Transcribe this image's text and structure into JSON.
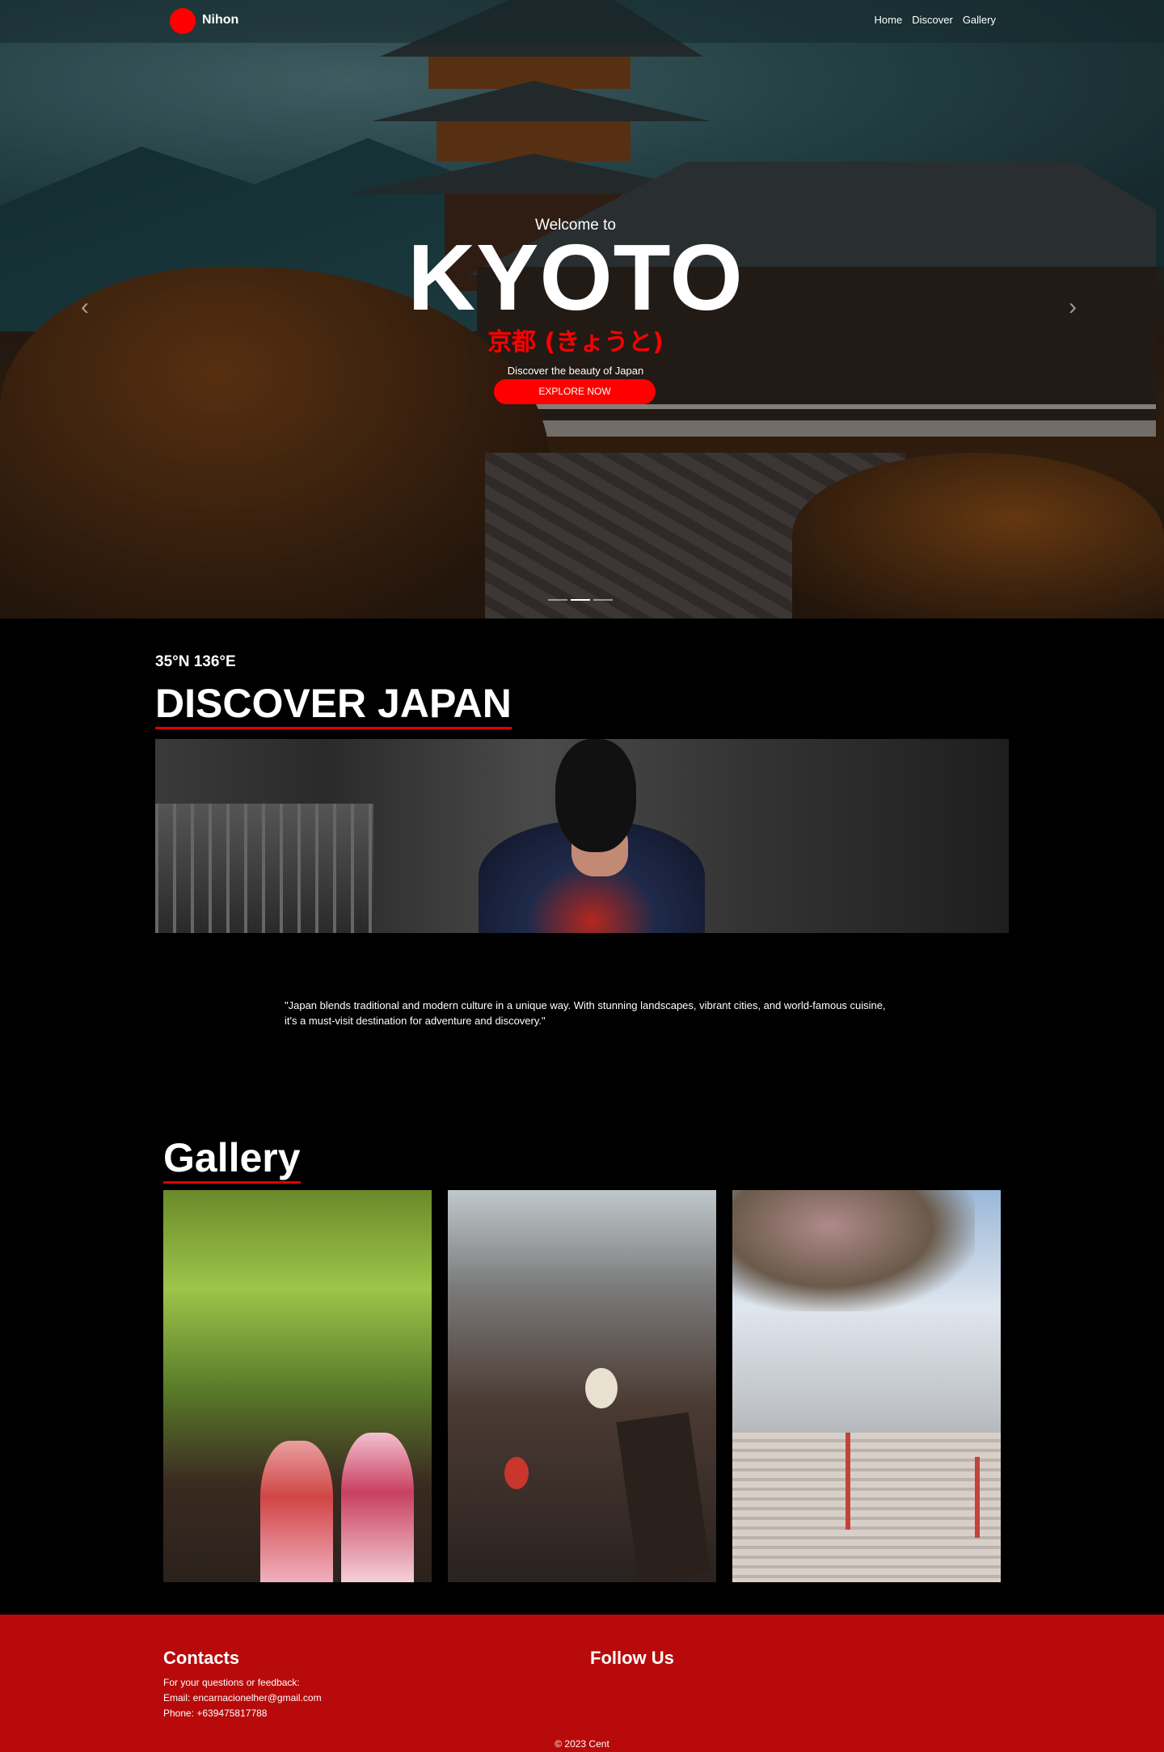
{
  "nav": {
    "brand": "Nihon",
    "links": [
      "Home",
      "Discover",
      "Gallery"
    ]
  },
  "hero": {
    "welcome": "Welcome to",
    "title": "KYOTO",
    "japanese": "京都 (きょうと)",
    "tagline": "Discover the beauty of Japan",
    "button": "EXPLORE NOW",
    "prev_icon": "chevron-left-icon",
    "next_icon": "chevron-right-icon",
    "slides": 3,
    "active_slide": 2
  },
  "discover": {
    "coords": "35°N 136°E",
    "title": "DISCOVER JAPAN",
    "quote": "\"Japan blends traditional and modern culture in a unique way. With stunning landscapes, vibrant cities, and world-famous cuisine, it's a must-visit destination for adventure and discovery.\""
  },
  "gallery": {
    "title": "Gallery"
  },
  "footer": {
    "contacts_title": "Contacts",
    "contacts_line1": "For your questions or feedback:",
    "contacts_email": "Email: encarnacionelher@gmail.com",
    "contacts_phone": "Phone: +639475817788",
    "follow_title": "Follow Us",
    "copyright": "© 2023 Cent"
  },
  "colors": {
    "accent": "#ff0000",
    "footer_bg": "#b80a0a",
    "background": "#000000"
  }
}
